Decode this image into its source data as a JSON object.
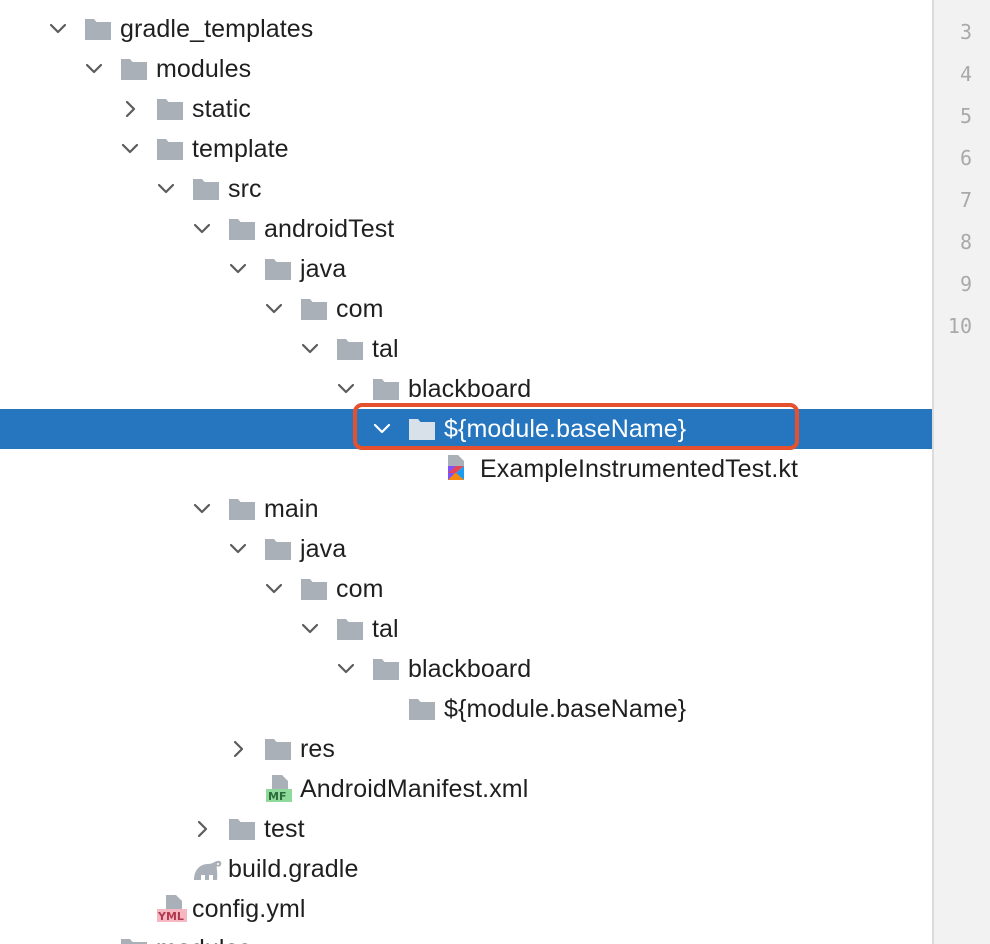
{
  "tree": {
    "rows": [
      {
        "label": "gradle_templates",
        "kind": "folder",
        "expand": "open",
        "name": "tree-node-gradle-templates",
        "depth": 0,
        "selected": false
      },
      {
        "label": "modules",
        "kind": "folder",
        "expand": "open",
        "name": "tree-node-modules",
        "depth": 1,
        "selected": false
      },
      {
        "label": "static",
        "kind": "folder",
        "expand": "closed",
        "name": "tree-node-static",
        "depth": 2,
        "selected": false
      },
      {
        "label": "template",
        "kind": "folder",
        "expand": "open",
        "name": "tree-node-template",
        "depth": 2,
        "selected": false
      },
      {
        "label": "src",
        "kind": "folder",
        "expand": "open",
        "name": "tree-node-src",
        "depth": 3,
        "selected": false
      },
      {
        "label": "androidTest",
        "kind": "folder",
        "expand": "open",
        "name": "tree-node-androidtest",
        "depth": 4,
        "selected": false
      },
      {
        "label": "java",
        "kind": "folder",
        "expand": "open",
        "name": "tree-node-java",
        "depth": 5,
        "selected": false
      },
      {
        "label": "com",
        "kind": "folder",
        "expand": "open",
        "name": "tree-node-com",
        "depth": 6,
        "selected": false
      },
      {
        "label": "tal",
        "kind": "folder",
        "expand": "open",
        "name": "tree-node-tal",
        "depth": 7,
        "selected": false
      },
      {
        "label": "blackboard",
        "kind": "folder",
        "expand": "open",
        "name": "tree-node-blackboard",
        "depth": 8,
        "selected": false
      },
      {
        "label": "${module.baseName}",
        "kind": "folder",
        "expand": "open",
        "name": "tree-node-module-basename",
        "depth": 9,
        "selected": true
      },
      {
        "label": "ExampleInstrumentedTest.kt",
        "kind": "kotlin",
        "expand": "none",
        "name": "tree-node-exampleinstrumentedtest",
        "depth": 10,
        "selected": false
      },
      {
        "label": "main",
        "kind": "folder",
        "expand": "open",
        "name": "tree-node-main",
        "depth": 4,
        "selected": false
      },
      {
        "label": "java",
        "kind": "folder",
        "expand": "open",
        "name": "tree-node-java",
        "depth": 5,
        "selected": false
      },
      {
        "label": "com",
        "kind": "folder",
        "expand": "open",
        "name": "tree-node-com",
        "depth": 6,
        "selected": false
      },
      {
        "label": "tal",
        "kind": "folder",
        "expand": "open",
        "name": "tree-node-tal",
        "depth": 7,
        "selected": false
      },
      {
        "label": "blackboard",
        "kind": "folder",
        "expand": "open",
        "name": "tree-node-blackboard",
        "depth": 8,
        "selected": false
      },
      {
        "label": "${module.baseName}",
        "kind": "folder",
        "expand": "none",
        "name": "tree-node-module-basename",
        "depth": 9,
        "selected": false
      },
      {
        "label": "res",
        "kind": "folder",
        "expand": "closed",
        "name": "tree-node-res",
        "depth": 5,
        "selected": false
      },
      {
        "label": "AndroidManifest.xml",
        "kind": "manifest",
        "expand": "none",
        "name": "tree-node-androidmanifest",
        "depth": 5,
        "selected": false
      },
      {
        "label": "test",
        "kind": "folder",
        "expand": "closed",
        "name": "tree-node-test",
        "depth": 4,
        "selected": false
      },
      {
        "label": "build.gradle",
        "kind": "gradle",
        "expand": "none",
        "name": "tree-node-build-gradle",
        "depth": 3,
        "selected": false
      },
      {
        "label": "config.yml",
        "kind": "yml",
        "expand": "none",
        "name": "tree-node-config-yml",
        "depth": 2,
        "selected": false
      },
      {
        "label": "modules",
        "kind": "folder",
        "expand": "none",
        "name": "tree-node-modules-cut",
        "depth": 1,
        "selected": false
      }
    ]
  },
  "gutter": {
    "line_numbers": [
      "3",
      "4",
      "5",
      "6",
      "7",
      "8",
      "9",
      "10"
    ]
  },
  "colors": {
    "selection": "#2675bf",
    "folder": "#aab0b7",
    "annotation": "#e5512f"
  },
  "icons": {
    "folder": "folder-icon",
    "kotlin": "kotlin-file-icon",
    "manifest": "manifest-file-icon",
    "gradle": "gradle-elephant-icon",
    "yml": "yml-file-icon",
    "chevron_open": "chevron-down-icon",
    "chevron_closed": "chevron-right-icon"
  }
}
